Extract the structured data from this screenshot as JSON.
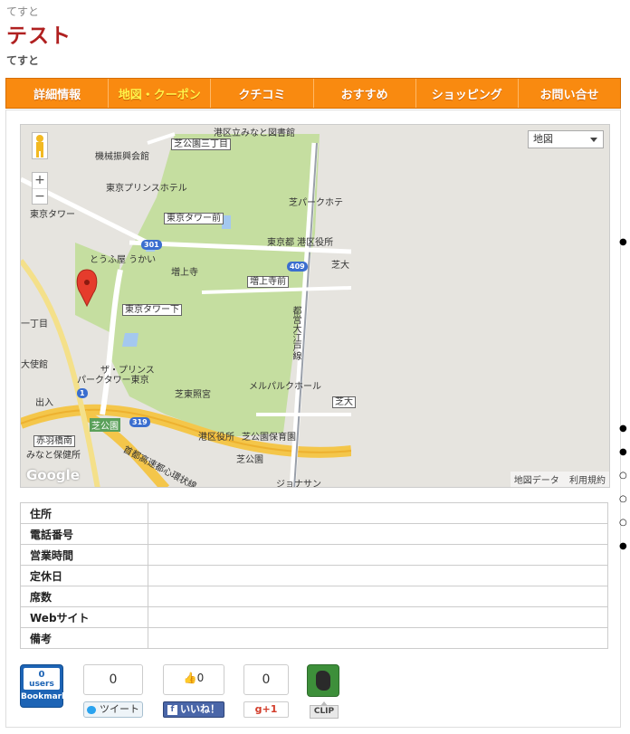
{
  "header": {
    "kana": "てすと",
    "title": "テスト",
    "description": "てすと"
  },
  "tabs": [
    {
      "label": "詳細情報",
      "active": false
    },
    {
      "label": "地図・クーポン",
      "active": true
    },
    {
      "label": "クチコミ",
      "active": false
    },
    {
      "label": "おすすめ",
      "active": false
    },
    {
      "label": "ショッピング",
      "active": false
    },
    {
      "label": "お問い合せ",
      "active": false
    }
  ],
  "map": {
    "maptype_selected": "地図",
    "footer": {
      "data": "地図データ",
      "terms": "利用規約"
    },
    "google": "Google",
    "labels": {
      "minato_library": "港区立みなと図書館",
      "shibakoen3": "芝公園三丁目",
      "kikai": "機械振興会館",
      "prince": "東京プリンスホテル",
      "shibapark": "芝パークホテ",
      "tokyo_tower": "東京タワー",
      "tokyo_tower_mae": "東京タワー前",
      "minato_office": "東京都 港区役所",
      "toufuya": "とうふ屋 うかい",
      "zojoji": "増上寺",
      "zojoji_mae": "増上寺前",
      "shibadai": "芝大",
      "tokyo_tower_shita": "東京タワー下",
      "itchome": "一丁目",
      "embassy": "大使館",
      "the_prince": "ザ・プリンス",
      "park_tower": "パークタワー東京",
      "melparque": "メルパルクホール",
      "toshogu": "芝東照宮",
      "shibadai2": "芝大",
      "deguchi": "出入",
      "shibakoen": "芝公園",
      "akabanebashi": "赤羽橋南",
      "minato_hoken": "みなと保健所",
      "ward_office": "港区役所",
      "shibakoen_hoikuen": "芝公園保育園",
      "shibakoen2": "芝公園",
      "shuto": "首都高速都心環状線",
      "oedo": "都営大江戸線",
      "jonathan": "ジョナサン",
      "route301": "301",
      "route409": "409",
      "route319": "319",
      "route1": "1"
    }
  },
  "info_table": [
    {
      "label": "住所",
      "value": ""
    },
    {
      "label": "電話番号",
      "value": ""
    },
    {
      "label": "営業時間",
      "value": ""
    },
    {
      "label": "定休日",
      "value": ""
    },
    {
      "label": "席数",
      "value": ""
    },
    {
      "label": "Webサイト",
      "value": ""
    },
    {
      "label": "備考",
      "value": ""
    }
  ],
  "social": {
    "hatena": {
      "count": "0",
      "unit": "users",
      "label": "Bookmark"
    },
    "twitter": {
      "count": "0",
      "label": "ツイート"
    },
    "facebook": {
      "count": "0",
      "label": "いいね！"
    },
    "gplus": {
      "count": "0",
      "label": "g+1"
    },
    "evernote": {
      "label": "CLIP"
    }
  },
  "colors": {
    "tab_bg": "#f98a10",
    "tab_active_text": "#fff34a",
    "title": "#b02020",
    "park": "#c5dea0"
  }
}
